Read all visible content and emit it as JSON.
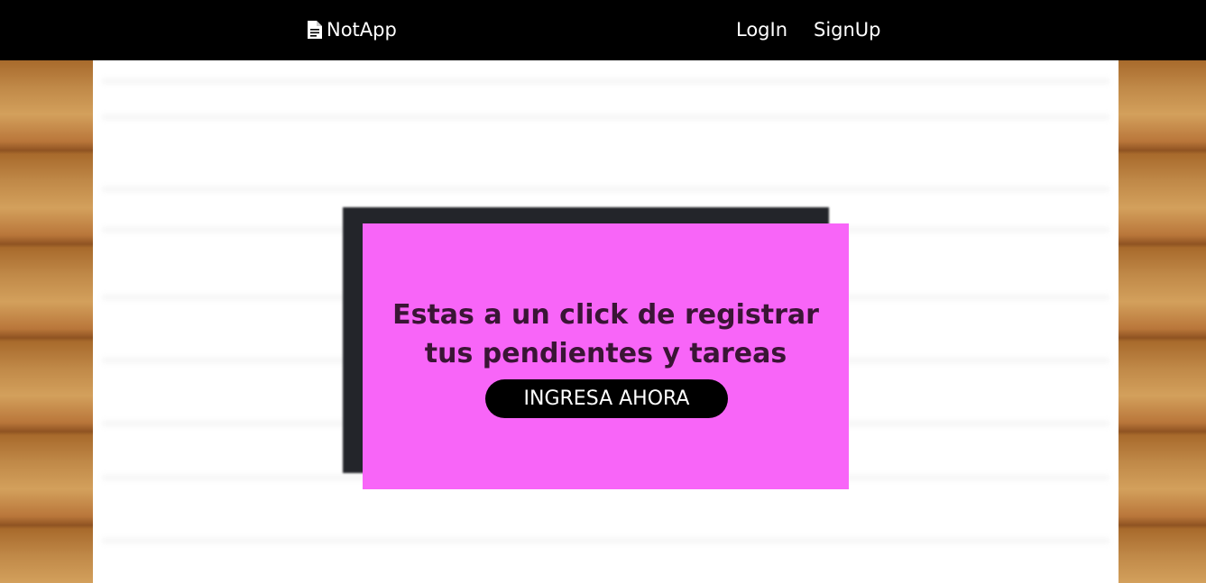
{
  "nav": {
    "brand_label": "NotApp",
    "brand_icon": "file-text-icon",
    "login_label": "LogIn",
    "signup_label": "SignUp",
    "background_color": "#000000"
  },
  "hero": {
    "title": "Estas a un click de registrar tus pendientes y tareas",
    "button_label": "INGRESA AHORA",
    "card_color": "#f865f8",
    "shadow_color": "#23252a",
    "button_color": "#000000"
  }
}
